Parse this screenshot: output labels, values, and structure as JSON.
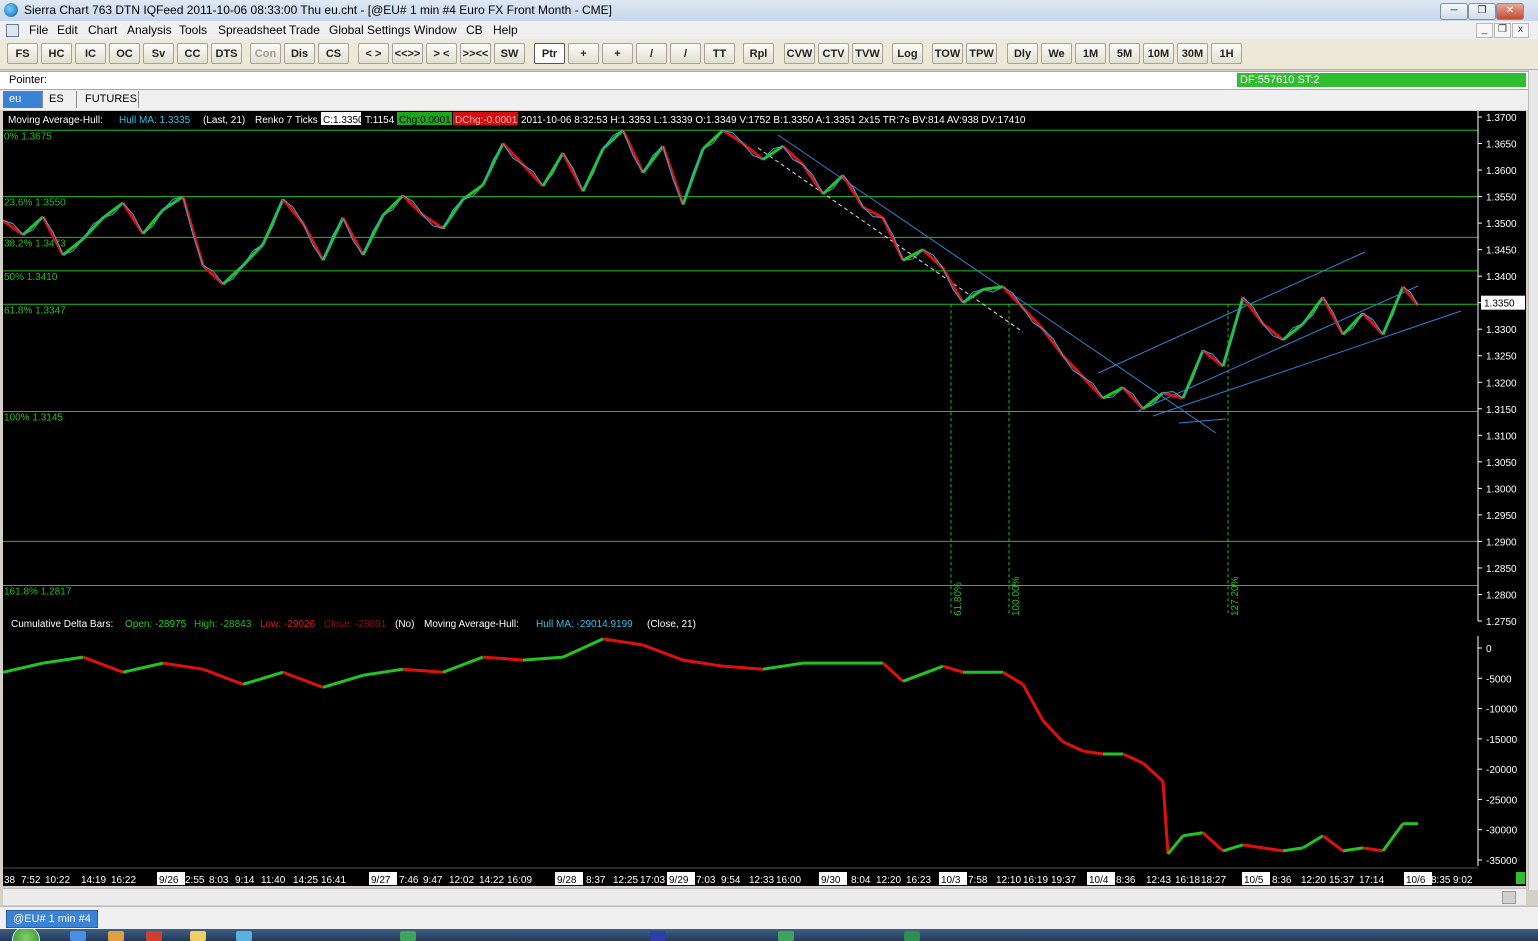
{
  "window": {
    "title": "Sierra Chart 763 DTN IQFeed 2011-10-06  08:33:00  Thu    eu.cht - [@EU#  1 min   #4  Euro FX Front Month - CME]"
  },
  "menu": [
    "File",
    "Edit",
    "Chart",
    "Analysis",
    "Tools",
    "Spreadsheet",
    "Trade",
    "Global Settings",
    "Window",
    "CB",
    "Help"
  ],
  "toolbar": [
    "FS",
    "HC",
    "IC",
    "OC",
    "Sv",
    "CC",
    "DTS",
    "Con",
    "Dis",
    "CS",
    "< >",
    "<<>>",
    "> <",
    ">><<",
    "SW",
    "Ptr",
    "+",
    "+",
    "/",
    "/",
    "TT",
    "Rpl",
    "CVW",
    "CTV",
    "TVW",
    "Log",
    "TOW",
    "TPW",
    "Dly",
    "We",
    "1M",
    "5M",
    "10M",
    "30M",
    "1H"
  ],
  "pointer_bar": {
    "label": "Pointer:",
    "status": "DF:557610   ST:2"
  },
  "tabs": [
    "eu",
    "ES",
    "FUTURES"
  ],
  "bottom_tab": "@EU#  1 min   #4",
  "colors": {
    "up": "#22c322",
    "down": "#e01010",
    "fib": "#1fbf1f",
    "trend": "#2f82d0",
    "hull": "#2fa7d8"
  },
  "main_header": {
    "study": "Moving Average-Hull:",
    "hull": "Hull MA: 1.3335",
    "params": "(Last, 21)",
    "renko": "Renko 7 Ticks",
    "close": "C:1.3350",
    "ticks": "T:1154",
    "chg": "Chg:0.0001",
    "dchg": "DChg:-0.0001",
    "rest": "2011-10-06 8:32:53 H:1.3353 L:1.3339 O:1.3349 V:1752 B:1.3350 A:1.3351 2x15 TR:7s BV:814 AV:938 DV:17410"
  },
  "sub_header": {
    "title": "Cumulative Delta Bars:",
    "open": "Open: -28975",
    "high": "High: -28843",
    "low": "Low: -29026",
    "close": "Close: -28891",
    "no": "(No)",
    "study": "Moving Average-Hull:",
    "hull": "Hull MA: -29014.9199",
    "params": "(Close, 21)"
  },
  "price_axis": [
    "1.3700",
    "1.3650",
    "1.3600",
    "1.3550",
    "1.3500",
    "1.3450",
    "1.3400",
    "1.3350",
    "1.3300",
    "1.3250",
    "1.3200",
    "1.3150",
    "1.3100",
    "1.3050",
    "1.3000",
    "1.2950",
    "1.2900",
    "1.2850",
    "1.2800",
    "1.2750"
  ],
  "price_current": "1.3350",
  "delta_axis": [
    "0",
    "-5000",
    "-10000",
    "-15000",
    "-20000",
    "-25000",
    "-30000",
    "-35000"
  ],
  "fib_levels": [
    {
      "label": "0% 1.3675",
      "price": 1.3675
    },
    {
      "label": "23.6% 1.3550",
      "price": 1.355
    },
    {
      "label": "38.2% 1.3473",
      "price": 1.3473
    },
    {
      "label": "50% 1.3410",
      "price": 1.341
    },
    {
      "label": "61.8% 1.3347",
      "price": 1.3347
    },
    {
      "label": "100% 1.3145",
      "price": 1.3145
    },
    {
      "label": "",
      "price": 1.29
    },
    {
      "label": "161.8% 1.2817",
      "price": 1.2817
    }
  ],
  "projection_labels": [
    "61.80%",
    "100.00%",
    "127.20%"
  ],
  "time_axis": [
    {
      "t": "38",
      "date": false
    },
    {
      "t": "7:52",
      "date": false
    },
    {
      "t": "10:22",
      "date": false
    },
    {
      "t": "14:19",
      "date": false
    },
    {
      "t": "16:22",
      "date": false
    },
    {
      "t": "9/26",
      "date": true
    },
    {
      "t": "2:55",
      "date": false
    },
    {
      "t": "8:03",
      "date": false
    },
    {
      "t": "9:14",
      "date": false
    },
    {
      "t": "11:40",
      "date": false
    },
    {
      "t": "14:25",
      "date": false
    },
    {
      "t": "16:41",
      "date": false
    },
    {
      "t": "9/27",
      "date": true
    },
    {
      "t": "7:46",
      "date": false
    },
    {
      "t": "9:47",
      "date": false
    },
    {
      "t": "12:02",
      "date": false
    },
    {
      "t": "14:22",
      "date": false
    },
    {
      "t": "16:09",
      "date": false
    },
    {
      "t": "9/28",
      "date": true
    },
    {
      "t": "8:37",
      "date": false
    },
    {
      "t": "12:25",
      "date": false
    },
    {
      "t": "17:03",
      "date": false
    },
    {
      "t": "9/29",
      "date": true
    },
    {
      "t": "7:03",
      "date": false
    },
    {
      "t": "9:54",
      "date": false
    },
    {
      "t": "12:33",
      "date": false
    },
    {
      "t": "16:00",
      "date": false
    },
    {
      "t": "9/30",
      "date": true
    },
    {
      "t": "8:04",
      "date": false
    },
    {
      "t": "12:20",
      "date": false
    },
    {
      "t": "16:23",
      "date": false
    },
    {
      "t": "10/3",
      "date": true
    },
    {
      "t": "7:58",
      "date": false
    },
    {
      "t": "12:10",
      "date": false
    },
    {
      "t": "16:19",
      "date": false
    },
    {
      "t": "19:37",
      "date": false
    },
    {
      "t": "10/4",
      "date": true
    },
    {
      "t": "8:36",
      "date": false
    },
    {
      "t": "12:43",
      "date": false
    },
    {
      "t": "16:18",
      "date": false
    },
    {
      "t": "18:27",
      "date": false
    },
    {
      "t": "10/5",
      "date": true
    },
    {
      "t": "8:36",
      "date": false
    },
    {
      "t": "12:20",
      "date": false
    },
    {
      "t": "15:37",
      "date": false
    },
    {
      "t": "17:14",
      "date": false
    },
    {
      "t": "10/6",
      "date": true
    },
    {
      "t": "8:35",
      "date": false
    },
    {
      "t": "9:02",
      "date": false
    }
  ],
  "chart_data": {
    "type": "line",
    "series": [
      {
        "x": [
          0,
          20,
          40,
          60,
          80,
          100,
          120,
          140,
          160,
          180,
          200,
          220,
          240,
          260,
          280,
          300,
          320,
          340,
          360,
          380,
          400,
          420,
          440,
          460,
          480,
          500,
          520,
          540,
          560,
          580,
          600,
          620,
          640,
          660,
          680,
          700,
          720,
          740,
          760,
          780,
          800,
          820,
          840,
          860,
          880,
          900,
          920,
          940,
          960,
          980,
          1000,
          1020,
          1040,
          1060,
          1080,
          1100,
          1120,
          1140,
          1160,
          1180,
          1200,
          1220,
          1240,
          1260,
          1280,
          1300,
          1320,
          1340,
          1360,
          1380,
          1400,
          1415
        ],
        "values": [
          1.3505,
          1.3478,
          1.3512,
          1.344,
          1.347,
          1.351,
          1.3538,
          1.348,
          1.3525,
          1.355,
          1.342,
          1.3385,
          1.342,
          1.346,
          1.3545,
          1.35,
          1.343,
          1.351,
          1.344,
          1.3515,
          1.3552,
          1.3515,
          1.349,
          1.3545,
          1.3572,
          1.365,
          1.361,
          1.357,
          1.3632,
          1.356,
          1.364,
          1.3675,
          1.3595,
          1.3645,
          1.3535,
          1.364,
          1.3675,
          1.365,
          1.362,
          1.3645,
          1.361,
          1.3555,
          1.359,
          1.353,
          1.351,
          1.343,
          1.345,
          1.3415,
          1.335,
          1.3375,
          1.338,
          1.334,
          1.33,
          1.325,
          1.321,
          1.317,
          1.319,
          1.315,
          1.318,
          1.317,
          1.326,
          1.323,
          1.336,
          1.331,
          1.328,
          1.331,
          1.336,
          1.329,
          1.333,
          1.329,
          1.338,
          1.3345
        ]
      },
      {
        "x": [
          0,
          40,
          80,
          120,
          160,
          200,
          240,
          280,
          320,
          360,
          400,
          440,
          480,
          520,
          560,
          600,
          640,
          680,
          720,
          760,
          800,
          840,
          880,
          900,
          940,
          960,
          1000,
          1020,
          1040,
          1060,
          1080,
          1100,
          1120,
          1140,
          1160,
          1165,
          1180,
          1200,
          1220,
          1240,
          1260,
          1280,
          1300,
          1320,
          1340,
          1360,
          1380,
          1400,
          1415
        ],
        "values": [
          -4000,
          -2500,
          -1500,
          -4000,
          -2500,
          -3500,
          -6000,
          -4000,
          -6500,
          -4500,
          -3500,
          -4000,
          -1500,
          -2000,
          -1500,
          1500,
          500,
          -2000,
          -3000,
          -3500,
          -2500,
          -2500,
          -2500,
          -5500,
          -3000,
          -4000,
          -4000,
          -6000,
          -12000,
          -15500,
          -17000,
          -17500,
          -17500,
          -19000,
          -22000,
          -34000,
          -31000,
          -30500,
          -33500,
          -32500,
          -33000,
          -33500,
          -33000,
          -31000,
          -33500,
          -33000,
          -33500,
          -29000,
          -29000
        ]
      }
    ],
    "ylim": [
      1.275,
      1.37
    ],
    "y2lim": [
      -35000,
      0
    ]
  }
}
